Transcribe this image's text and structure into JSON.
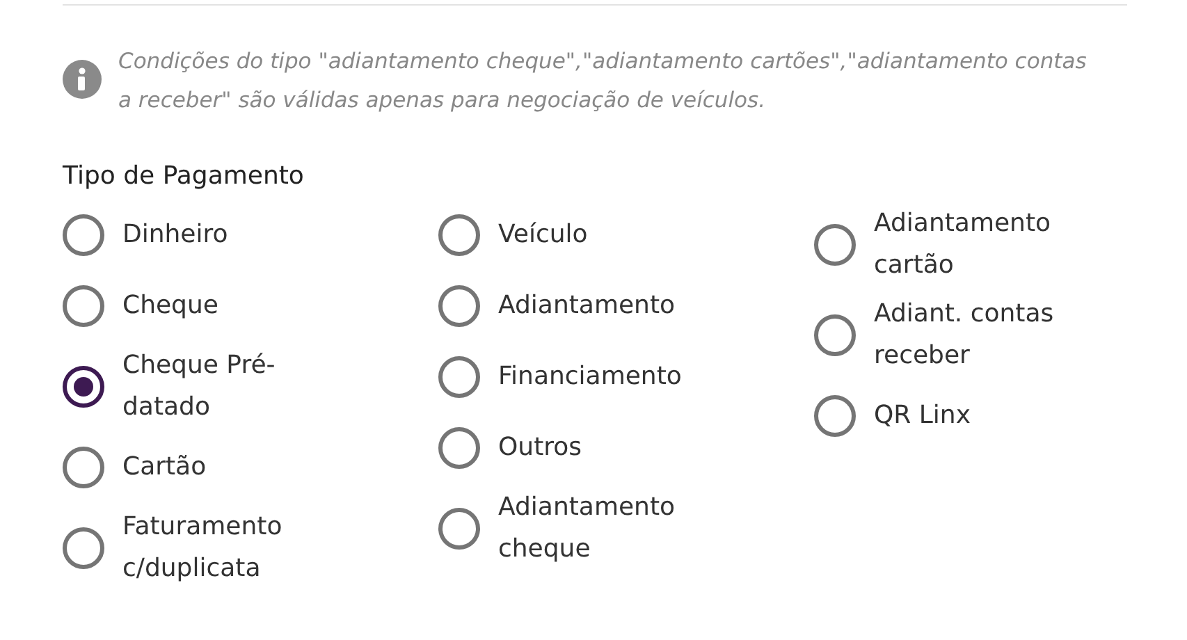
{
  "notice": {
    "text": "Condições do tipo \"adiantamento cheque\",\"adiantamento cartões\",\"adiantamento contas a receber\" são válidas apenas para negociação de veículos."
  },
  "payment_type": {
    "title": "Tipo de Pagamento",
    "columns": [
      {
        "options": [
          {
            "label": "Dinheiro",
            "selected": false
          },
          {
            "label": "Cheque",
            "selected": false
          },
          {
            "label": "Cheque Pré-datado",
            "selected": true
          },
          {
            "label": "Cartão",
            "selected": false
          },
          {
            "label": "Faturamento c/duplicata",
            "selected": false
          }
        ]
      },
      {
        "options": [
          {
            "label": "Veículo",
            "selected": false
          },
          {
            "label": "Adiantamento",
            "selected": false
          },
          {
            "label": "Financiamento",
            "selected": false
          },
          {
            "label": "Outros",
            "selected": false
          },
          {
            "label": "Adiantamento cheque",
            "selected": false
          }
        ]
      },
      {
        "options": [
          {
            "label": "Adiantamento cartão",
            "selected": false
          },
          {
            "label": "Adiant. contas receber",
            "selected": false
          },
          {
            "label": "QR Linx",
            "selected": false
          }
        ]
      }
    ]
  }
}
